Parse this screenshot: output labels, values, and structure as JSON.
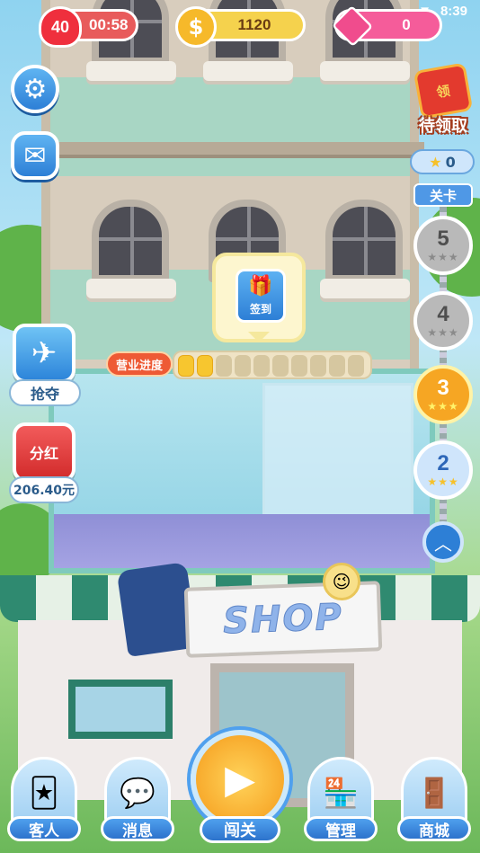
{
  "status_bar": {
    "time": "8:39"
  },
  "hud": {
    "lives": "40",
    "life_timer": "00:58",
    "coins": "1120",
    "gems": "0"
  },
  "left_menu": {
    "settings_icon": "gear-icon",
    "mail_icon": "envelope-icon",
    "grab_label": "抢夺",
    "dividend_badge": "分红",
    "dividend_amount": "206.40元"
  },
  "right_menu": {
    "pending_label": "待领取",
    "pending_badge": "领",
    "stars_count": "0",
    "level_tag": "关卡",
    "levels": [
      {
        "num": "5",
        "state": "locked",
        "stars": "★★★"
      },
      {
        "num": "4",
        "state": "locked",
        "stars": "★★★"
      },
      {
        "num": "3",
        "state": "current",
        "stars": "★★★"
      },
      {
        "num": "2",
        "state": "done",
        "stars": "★★★"
      }
    ]
  },
  "signin": {
    "label": "签到"
  },
  "business_progress": {
    "label": "营业进度",
    "filled": 2,
    "total": 10
  },
  "shop": {
    "sign_text": "SHOP"
  },
  "bottom_nav": {
    "customers": "客人",
    "messages": "消息",
    "play": "闯关",
    "manage": "管理",
    "store": "商城"
  }
}
